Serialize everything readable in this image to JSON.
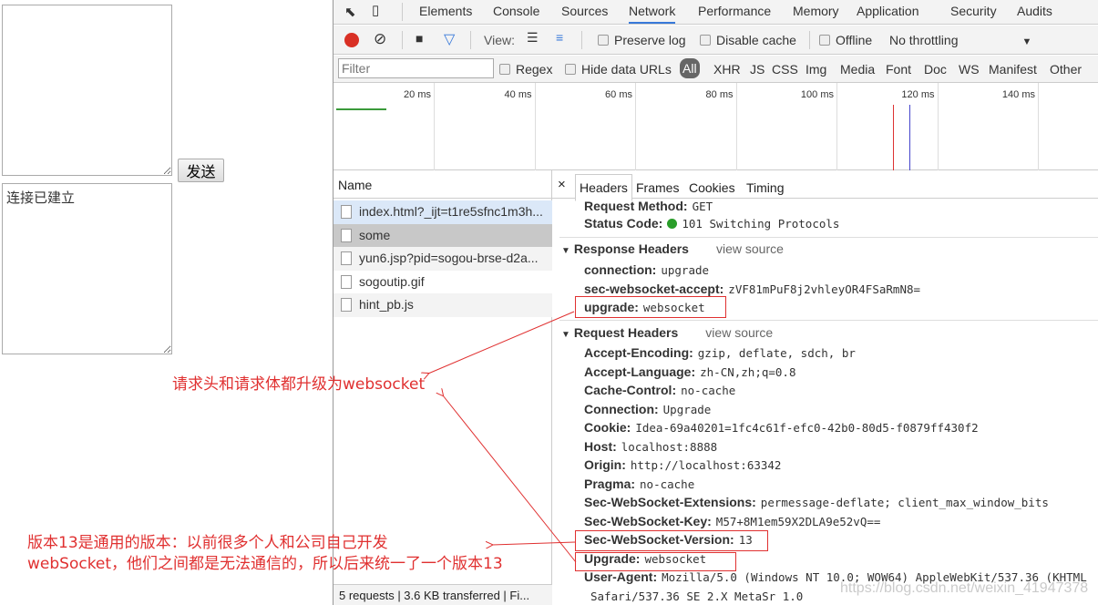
{
  "page": {
    "input_value": "",
    "send_button": "发送",
    "output_value": "连接已建立"
  },
  "devtools": {
    "tabs": [
      "Elements",
      "Console",
      "Sources",
      "Network",
      "Performance",
      "Memory",
      "Application",
      "Security",
      "Audits"
    ],
    "active_tab": "Network",
    "toolbar": {
      "view_label": "View:",
      "preserve_log": "Preserve log",
      "disable_cache": "Disable cache",
      "offline": "Offline",
      "throttling": "No throttling"
    },
    "filter": {
      "placeholder": "Filter",
      "regex": "Regex",
      "hide_data_urls": "Hide data URLs",
      "types": [
        "All",
        "XHR",
        "JS",
        "CSS",
        "Img",
        "Media",
        "Font",
        "Doc",
        "WS",
        "Manifest",
        "Other"
      ]
    },
    "timeline_ticks": [
      "20 ms",
      "40 ms",
      "60 ms",
      "80 ms",
      "100 ms",
      "120 ms",
      "140 ms"
    ],
    "requests": {
      "header": "Name",
      "items": [
        "index.html?_ijt=t1re5sfnc1m3h...",
        "some",
        "yun6.jsp?pid=sogou-brse-d2a...",
        "sogoutip.gif",
        "hint_pb.js"
      ],
      "selected": "some"
    },
    "status_bar": "5 requests | 3.6 KB transferred | Fi...",
    "detail_tabs": [
      "Headers",
      "Frames",
      "Cookies",
      "Timing"
    ],
    "general": [
      {
        "k": "Request Method:",
        "v": "GET"
      },
      {
        "k": "Status Code:",
        "v": "101 Switching Protocols"
      }
    ],
    "response_headers": {
      "title": "Response Headers",
      "view_source": "view source",
      "items": [
        {
          "k": "connection:",
          "v": "upgrade"
        },
        {
          "k": "sec-websocket-accept:",
          "v": "zVF81mPuF8j2vhleyOR4FSaRmN8="
        },
        {
          "k": "upgrade:",
          "v": "websocket"
        }
      ]
    },
    "request_headers": {
      "title": "Request Headers",
      "view_source": "view source",
      "items": [
        {
          "k": "Accept-Encoding:",
          "v": "gzip, deflate, sdch, br"
        },
        {
          "k": "Accept-Language:",
          "v": "zh-CN,zh;q=0.8"
        },
        {
          "k": "Cache-Control:",
          "v": "no-cache"
        },
        {
          "k": "Connection:",
          "v": "Upgrade"
        },
        {
          "k": "Cookie:",
          "v": "Idea-69a40201=1fc4c61f-efc0-42b0-80d5-f0879ff430f2"
        },
        {
          "k": "Host:",
          "v": "localhost:8888"
        },
        {
          "k": "Origin:",
          "v": "http://localhost:63342"
        },
        {
          "k": "Pragma:",
          "v": "no-cache"
        },
        {
          "k": "Sec-WebSocket-Extensions:",
          "v": "permessage-deflate; client_max_window_bits"
        },
        {
          "k": "Sec-WebSocket-Key:",
          "v": "M57+8M1em59X2DLA9e52vQ=="
        },
        {
          "k": "Sec-WebSocket-Version:",
          "v": "13"
        },
        {
          "k": "Upgrade:",
          "v": "websocket"
        },
        {
          "k": "User-Agent:",
          "v": "Mozilla/5.0 (Windows NT 10.0; WOW64) AppleWebKit/537.36 (KHTML"
        }
      ],
      "continuation": "Safari/537.36 SE 2.X MetaSr 1.0"
    }
  },
  "annotations": {
    "upgrade_note": "请求头和请求体都升级为websocket",
    "version_note_1": "版本13是通用的版本：以前很多个人和公司自己开发",
    "version_note_2": "webSocket，他们之间都是无法通信的，所以后来统一了一个版本13"
  },
  "watermark": "https://blog.csdn.net/weixin_41947378",
  "colors": {
    "annotation": "#e03030",
    "record": "#d93025",
    "status_ok": "#2a9d2a",
    "accent": "#3879d9"
  }
}
